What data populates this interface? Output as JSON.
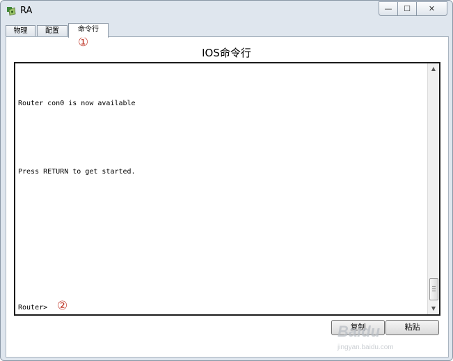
{
  "window": {
    "title": "RA",
    "controls": {
      "minimize": "—",
      "maximize": "☐",
      "close": "✕"
    }
  },
  "tabs": [
    {
      "label": "物理"
    },
    {
      "label": "配置"
    },
    {
      "label": "命令行",
      "active": true
    }
  ],
  "annotations": {
    "tab_marker": "①",
    "prompt_marker": "②"
  },
  "panel": {
    "heading": "IOS命令行"
  },
  "console": {
    "lines": [
      "Router con0 is now available",
      "Press RETURN to get started.",
      "Router>"
    ]
  },
  "scrollbar": {
    "up": "▲",
    "down": "▼"
  },
  "buttons": {
    "copy": "复制",
    "paste": "粘贴"
  },
  "watermark": {
    "logo": "Baidu",
    "url": "jingyan.baidu.com"
  },
  "colors": {
    "marker": "#c0392b",
    "frame": "#dfe6ee"
  }
}
